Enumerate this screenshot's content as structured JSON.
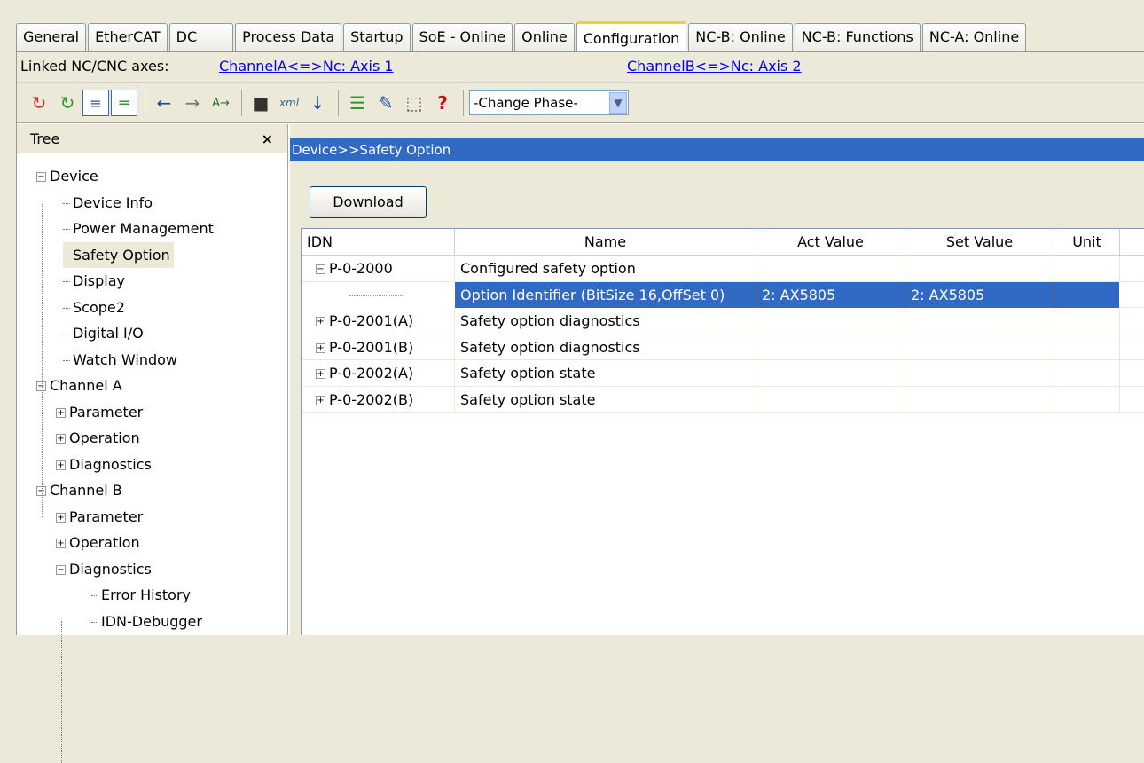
{
  "tabs": [
    "General",
    "EtherCAT",
    "DC",
    "Process Data",
    "Startup",
    "SoE - Online",
    "Online",
    "Configuration",
    "NC-B: Online",
    "NC-B: Functions",
    "NC-A: Online"
  ],
  "active_tab": "Configuration",
  "linked": {
    "label": "Linked NC/CNC axes:",
    "link_a": "ChannelA<=>Nc: Axis 1",
    "link_b": "ChannelB<=>Nc: Axis 2"
  },
  "toolbar": {
    "help_glyph": "?",
    "phase_value": "-Change Phase-",
    "icons": [
      "refresh-red-icon",
      "refresh-green-icon",
      "tree-view-icon",
      "split-view-icon",
      "back-arrow-icon",
      "forward-arrow-icon",
      "text-compare-icon",
      "device-icon",
      "xml-icon",
      "download-list-icon",
      "checklist-icon",
      "edit-icon",
      "select-icon",
      "help-icon"
    ]
  },
  "tree": {
    "title": "Tree",
    "close": "×",
    "items": [
      {
        "label": "Device",
        "box": "-"
      },
      {
        "label": "Device Info"
      },
      {
        "label": "Power Management"
      },
      {
        "label": "Safety Option"
      },
      {
        "label": "Display"
      },
      {
        "label": "Scope2"
      },
      {
        "label": "Digital I/O"
      },
      {
        "label": "Watch Window"
      },
      {
        "label": "Channel A",
        "box": "-"
      },
      {
        "label": "Parameter",
        "box": "+"
      },
      {
        "label": "Operation",
        "box": "+"
      },
      {
        "label": "Diagnostics",
        "box": "+"
      },
      {
        "label": "Channel B",
        "box": "-"
      },
      {
        "label": "Parameter",
        "box": "+"
      },
      {
        "label": "Operation",
        "box": "+"
      },
      {
        "label": "Diagnostics",
        "box": "-"
      },
      {
        "label": "Error History"
      },
      {
        "label": "IDN-Debugger"
      }
    ]
  },
  "panel": {
    "breadcrumb": "Device>>Safety Option",
    "download_label": "Download"
  },
  "grid": {
    "columns": [
      "IDN",
      "Name",
      "Act Value",
      "Set Value",
      "Unit"
    ],
    "rows": [
      {
        "idn": "P-0-2000",
        "box": "-",
        "name": "Configured safety option",
        "act": "",
        "set": "",
        "unit": ""
      },
      {
        "idn": "",
        "name": "Option Identifier (BitSize 16,OffSet 0)",
        "act": "2: AX5805",
        "set": "2: AX5805",
        "unit": ""
      },
      {
        "idn": "P-0-2001(A)",
        "box": "+",
        "name": "Safety option diagnostics",
        "act": "",
        "set": "",
        "unit": ""
      },
      {
        "idn": "P-0-2001(B)",
        "box": "+",
        "name": "Safety option diagnostics",
        "act": "",
        "set": "",
        "unit": ""
      },
      {
        "idn": "P-0-2002(A)",
        "box": "+",
        "name": "Safety option state",
        "act": "",
        "set": "",
        "unit": ""
      },
      {
        "idn": "P-0-2002(B)",
        "box": "+",
        "name": "Safety option state",
        "act": "",
        "set": "",
        "unit": ""
      }
    ]
  }
}
